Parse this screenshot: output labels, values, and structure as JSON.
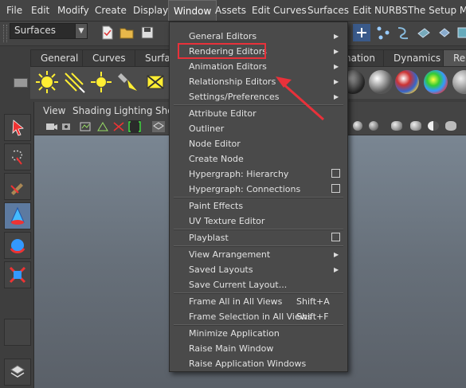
{
  "menubar": {
    "items": [
      "File",
      "Edit",
      "Modify",
      "Create",
      "Display",
      "Window",
      "Assets",
      "Edit Curves",
      "Surfaces",
      "Edit NURBS",
      "The Setup Mac"
    ],
    "active": "Window"
  },
  "status": {
    "menuset": "Surfaces"
  },
  "shelf": {
    "tabs": [
      "General",
      "Curves",
      "Surfa",
      "nation",
      "Dynamics",
      "Re"
    ],
    "selected_tab": "Re"
  },
  "panel": {
    "menus": [
      "View",
      "Shading",
      "Lighting",
      "Sho"
    ]
  },
  "window_menu": {
    "items": [
      {
        "label": "General Editors",
        "submenu": true
      },
      {
        "label": "Rendering Editors",
        "submenu": true,
        "highlighted": true
      },
      {
        "label": "Animation Editors",
        "submenu": true
      },
      {
        "label": "Relationship Editors",
        "submenu": true
      },
      {
        "label": "Settings/Preferences",
        "submenu": true
      },
      {
        "label": "Attribute Editor"
      },
      {
        "label": "Outliner"
      },
      {
        "label": "Node Editor"
      },
      {
        "label": "Create Node"
      },
      {
        "label": "Hypergraph: Hierarchy",
        "option_box": true
      },
      {
        "label": "Hypergraph: Connections",
        "option_box": true
      },
      {
        "label": "Paint Effects"
      },
      {
        "label": "UV Texture Editor"
      },
      {
        "label": "Playblast",
        "option_box": true
      },
      {
        "label": "View Arrangement",
        "submenu": true
      },
      {
        "label": "Saved Layouts",
        "submenu": true
      },
      {
        "label": "Save Current Layout..."
      },
      {
        "label": "Frame All in All Views",
        "shortcut": "Shift+A"
      },
      {
        "label": "Frame Selection in All Views",
        "shortcut": "Shift+F"
      },
      {
        "label": "Minimize Application"
      },
      {
        "label": "Raise Main Window"
      },
      {
        "label": "Raise Application Windows"
      }
    ]
  },
  "colors": {
    "highlight_box": "#e8313a",
    "annotation_arrow": "#e8313a",
    "menu_bg": "#4a4a4a",
    "viewport_top": "#7f8c99"
  }
}
